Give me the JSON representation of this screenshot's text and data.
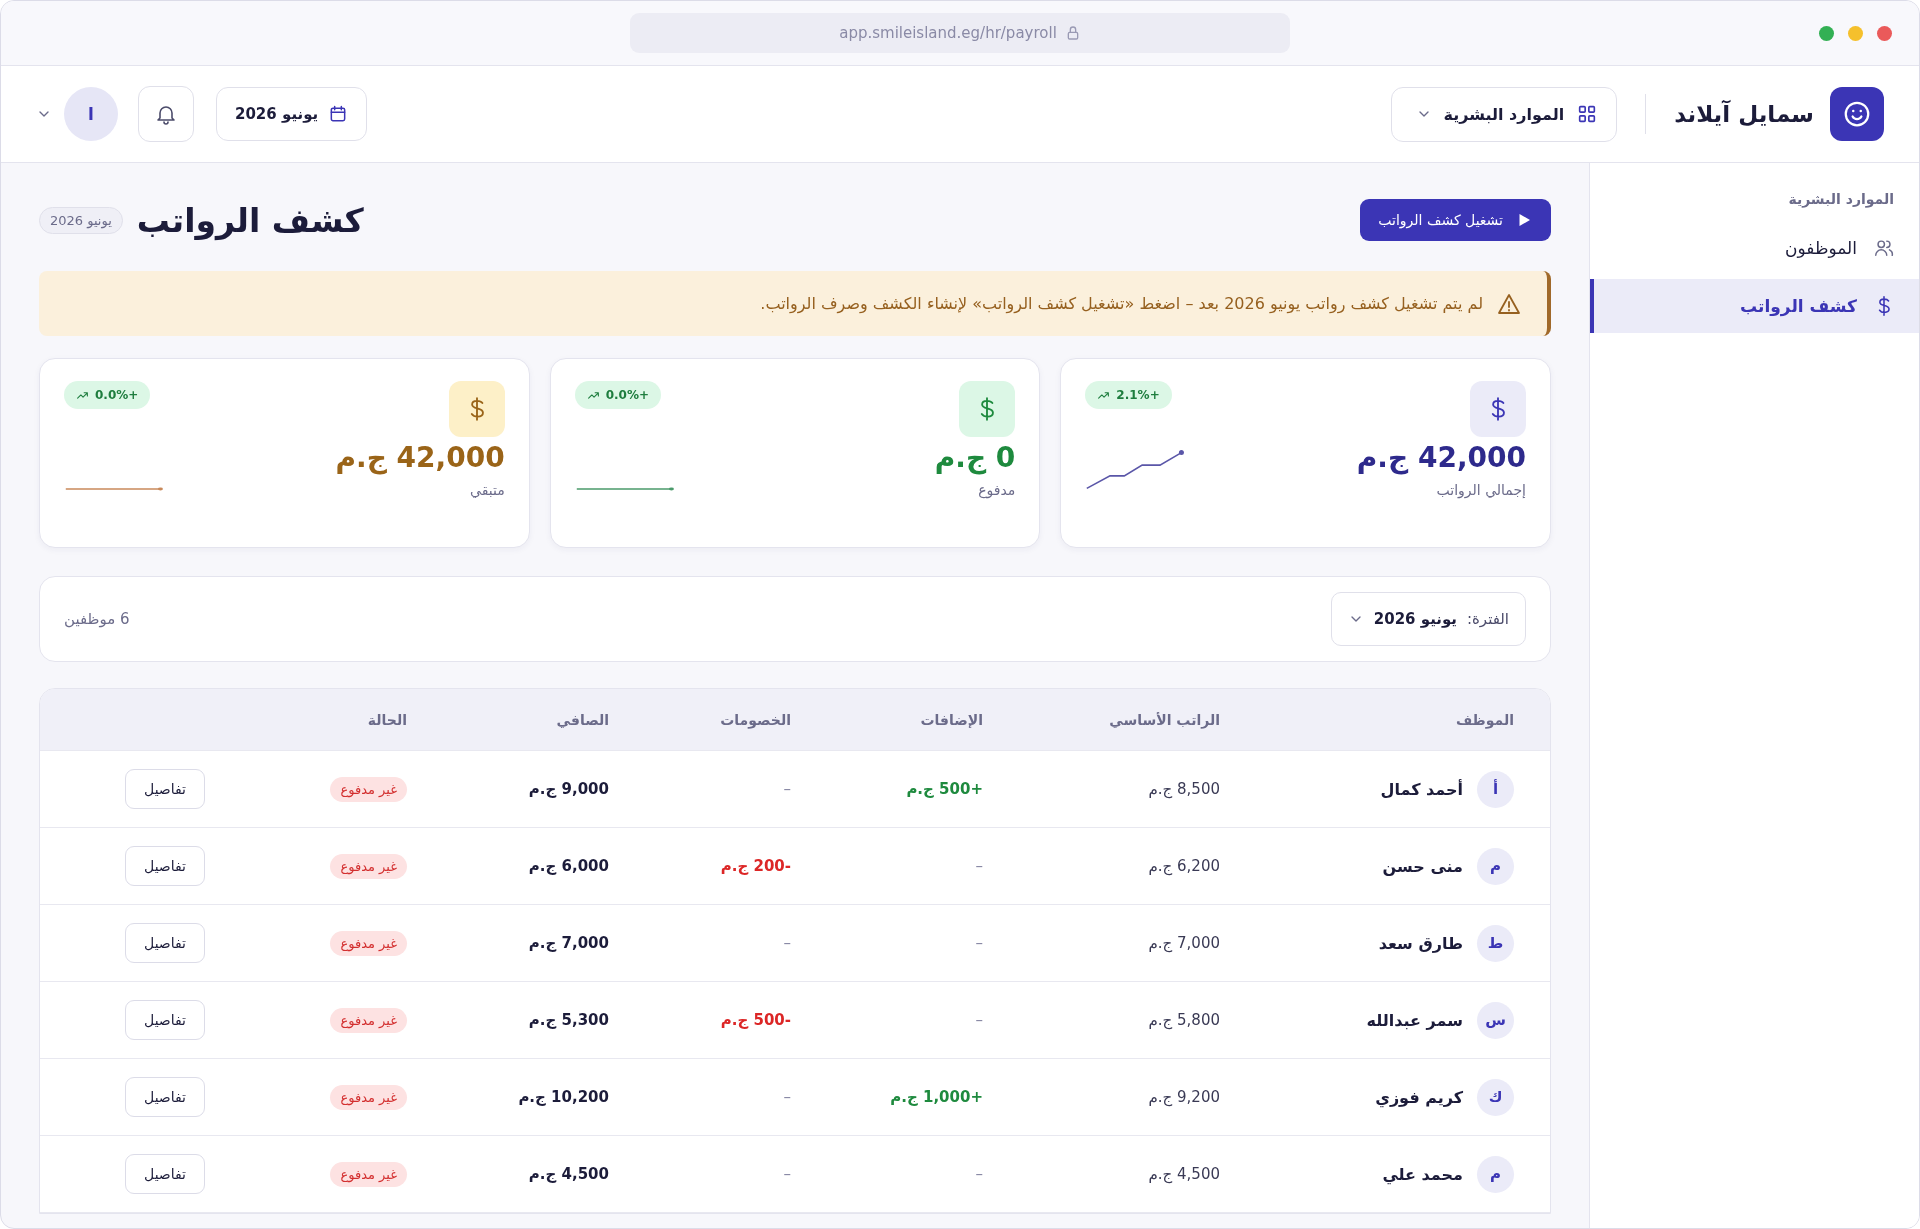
{
  "browser": {
    "url": "app.smileisland.eg/hr/payroll"
  },
  "topbar": {
    "brand": "سمايل آيلاند",
    "module": "الموارد البشرية",
    "period_button": "يونيو 2026",
    "avatar": "ا"
  },
  "sidebar": {
    "section": "الموارد البشرية",
    "items": [
      {
        "label": "الموظفون",
        "kind": "users",
        "selected": false
      },
      {
        "label": "كشف الرواتب",
        "kind": "money",
        "selected": true
      }
    ]
  },
  "page": {
    "title": "كشف الرواتب",
    "period_badge": "يونيو 2026",
    "run_button": "تشغيل كشف الرواتب"
  },
  "alert": {
    "text": "لم يتم تشغيل كشف رواتب يونيو 2026 بعد – اضغط «تشغيل كشف الرواتب» لإنشاء الكشف وصرف الرواتب."
  },
  "stats": [
    {
      "kind": "total",
      "value": "42,000 ج.م",
      "label": "إجمالي الرواتب",
      "trend": "+2.1%"
    },
    {
      "kind": "paid",
      "value": "0 ج.م",
      "label": "مدفوع",
      "trend": "+0.0%"
    },
    {
      "kind": "remaining",
      "value": "42,000 ج.م",
      "label": "متبقي",
      "trend": "+0.0%"
    }
  ],
  "filter": {
    "label": "الفترة:",
    "value": "يونيو 2026",
    "count": "6 موظفين"
  },
  "table": {
    "columns": [
      "الموظف",
      "الراتب الأساسي",
      "الإضافات",
      "الخصومات",
      "الصافي",
      "الحالة"
    ],
    "rows": [
      {
        "initial": "أ",
        "name": "أحمد كمال",
        "basic": "8,500 ج.م",
        "additions": {
          "text": "+500 ج.م",
          "kind": "credit"
        },
        "deductions": {
          "text": "–",
          "kind": "empty"
        },
        "net": "9,000 ج.م",
        "status": {
          "label": "غير مدفوع",
          "kind": "unpaid"
        },
        "action": "تفاصيل"
      },
      {
        "initial": "م",
        "name": "منى حسن",
        "basic": "6,200 ج.م",
        "additions": {
          "text": "–",
          "kind": "empty"
        },
        "deductions": {
          "text": "-200 ج.م",
          "kind": "debit"
        },
        "net": "6,000 ج.م",
        "status": {
          "label": "غير مدفوع",
          "kind": "unpaid"
        },
        "action": "تفاصيل"
      },
      {
        "initial": "ط",
        "name": "طارق سعد",
        "basic": "7,000 ج.م",
        "additions": {
          "text": "–",
          "kind": "empty"
        },
        "deductions": {
          "text": "–",
          "kind": "empty"
        },
        "net": "7,000 ج.م",
        "status": {
          "label": "غير مدفوع",
          "kind": "unpaid"
        },
        "action": "تفاصيل"
      },
      {
        "initial": "س",
        "name": "سمر عبدالله",
        "basic": "5,800 ج.م",
        "additions": {
          "text": "–",
          "kind": "empty"
        },
        "deductions": {
          "text": "-500 ج.م",
          "kind": "debit"
        },
        "net": "5,300 ج.م",
        "status": {
          "label": "غير مدفوع",
          "kind": "unpaid"
        },
        "action": "تفاصيل"
      },
      {
        "initial": "ك",
        "name": "كريم فوزي",
        "basic": "9,200 ج.م",
        "additions": {
          "text": "+1,000 ج.م",
          "kind": "credit"
        },
        "deductions": {
          "text": "–",
          "kind": "empty"
        },
        "net": "10,200 ج.م",
        "status": {
          "label": "غير مدفوع",
          "kind": "unpaid"
        },
        "action": "تفاصيل"
      },
      {
        "initial": "م",
        "name": "محمد علي",
        "basic": "4,500 ج.م",
        "additions": {
          "text": "–",
          "kind": "empty"
        },
        "deductions": {
          "text": "–",
          "kind": "empty"
        },
        "net": "4,500 ج.م",
        "status": {
          "label": "غير مدفوع",
          "kind": "unpaid"
        },
        "action": "تفاصيل"
      }
    ]
  }
}
